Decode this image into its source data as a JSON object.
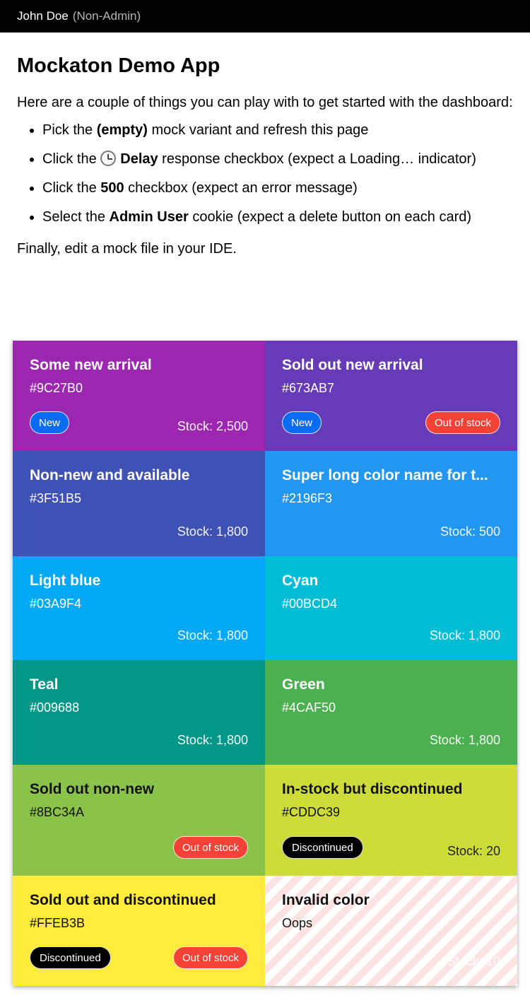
{
  "user": {
    "name": "John Doe",
    "role": "(Non-Admin)"
  },
  "title": "Mockaton Demo App",
  "intro_text": "Here are a couple of things you can play with to get started with the dashboard:",
  "tips": [
    {
      "pre": "Pick the ",
      "bold": "(empty)",
      "post": " mock variant and refresh this page"
    },
    {
      "pre": "Click the ",
      "bold": "Delay",
      "post": " response checkbox (expect a Loading… indicator)",
      "icon": "clock-icon"
    },
    {
      "pre": "Click the ",
      "bold": "500",
      "post": " checkbox (expect an error message)"
    },
    {
      "pre": "Select the ",
      "bold": "Admin User",
      "post": " cookie (expect a delete button on each card)"
    }
  ],
  "outro": "Finally, edit a mock file in your IDE.",
  "cards": [
    {
      "name": "Some new arrival",
      "hex": "#9C27B0",
      "color": "#9C27B0",
      "stock": "Stock: 2,500",
      "new_label": "New"
    },
    {
      "name": "Sold out new arrival",
      "hex": "#673AB7",
      "color": "#673AB7",
      "new_label": "New",
      "oos_label": "Out of stock"
    },
    {
      "name": "Non-new and available",
      "hex": "#3F51B5",
      "color": "#3F51B5",
      "stock": "Stock: 1,800"
    },
    {
      "name": "Super long color name for t...",
      "hex": "#2196F3",
      "color": "#2196F3",
      "stock": "Stock: 500"
    },
    {
      "name": "Light blue",
      "hex": "#03A9F4",
      "color": "#03A9F4",
      "stock": "Stock: 1,800"
    },
    {
      "name": "Cyan",
      "hex": "#00BCD4",
      "color": "#00BCD4",
      "stock": "Stock: 1,800"
    },
    {
      "name": "Teal",
      "hex": "#009688",
      "color": "#009688",
      "stock": "Stock: 1,800"
    },
    {
      "name": "Green",
      "hex": "#4CAF50",
      "color": "#4CAF50",
      "stock": "Stock: 1,800"
    },
    {
      "name": "Sold out non-new",
      "hex": "#8BC34A",
      "color": "#8BC34A",
      "oos_label": "Out of stock"
    },
    {
      "name": "In-stock but discontinued",
      "hex": "#CDDC39",
      "color": "#CDDC39",
      "stock": "Stock: 20",
      "disc_label": "Discontinued"
    },
    {
      "name": "Sold out and discontinued",
      "hex": "#FFEB3B",
      "color": "#FFEB3B",
      "disc_label": "Discontinued",
      "oos_label": "Out of stock"
    },
    {
      "name": "Invalid color",
      "hex": "Oops",
      "color": "invalid",
      "stock": "Stock: 10"
    }
  ]
}
